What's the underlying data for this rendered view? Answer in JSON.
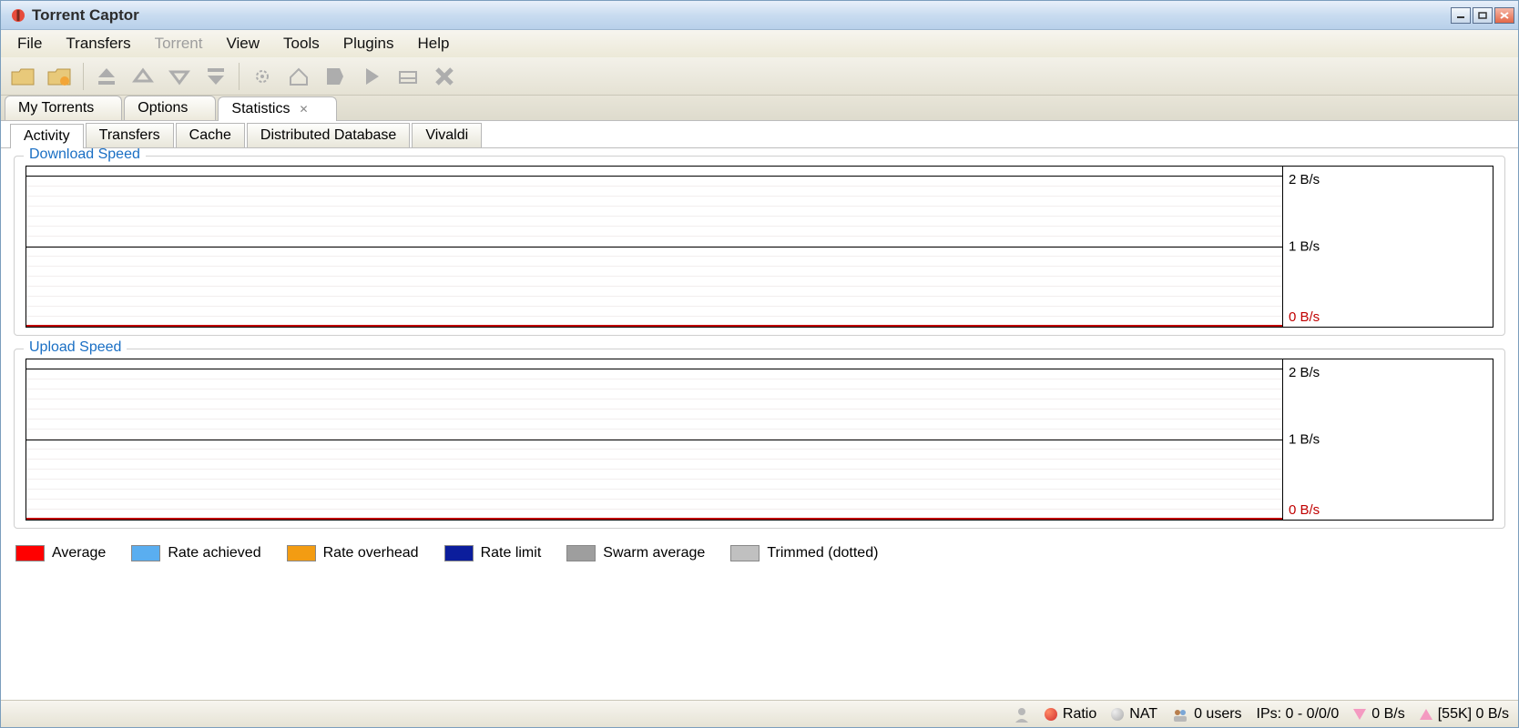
{
  "window": {
    "title": "Torrent Captor"
  },
  "menu": {
    "items": [
      "File",
      "Transfers",
      "Torrent",
      "View",
      "Tools",
      "Plugins",
      "Help"
    ],
    "disabled_index": 2
  },
  "primary_tabs": {
    "items": [
      "My Torrents",
      "Options",
      "Statistics"
    ],
    "active_index": 2,
    "closable_index": 2
  },
  "sub_tabs": {
    "items": [
      "Activity",
      "Transfers",
      "Cache",
      "Distributed Database",
      "Vivaldi"
    ],
    "active_index": 0
  },
  "charts": {
    "download": {
      "title": "Download Speed",
      "y_ticks": [
        "2 B/s",
        "1 B/s",
        "0 B/s"
      ]
    },
    "upload": {
      "title": "Upload Speed",
      "y_ticks": [
        "2 B/s",
        "1 B/s",
        "0 B/s"
      ]
    }
  },
  "legend": [
    {
      "label": "Average",
      "color": "#ff0000"
    },
    {
      "label": "Rate achieved",
      "color": "#5aaef0"
    },
    {
      "label": "Rate overhead",
      "color": "#f39c12"
    },
    {
      "label": "Rate limit",
      "color": "#0b1d9c"
    },
    {
      "label": "Swarm average",
      "color": "#9e9e9e"
    },
    {
      "label": "Trimmed (dotted)",
      "color": "#c0c0c0"
    }
  ],
  "status": {
    "ratio_label": "Ratio",
    "nat_label": "NAT",
    "users": "0 users",
    "ips": "IPs: 0 - 0/0/0",
    "down_rate": "0 B/s",
    "up_rate": "[55K] 0 B/s"
  },
  "chart_data": [
    {
      "type": "line",
      "title": "Download Speed",
      "series": [],
      "ylabel": "B/s",
      "ylim": [
        0,
        2
      ],
      "y_ticks": [
        0,
        1,
        2
      ]
    },
    {
      "type": "line",
      "title": "Upload Speed",
      "series": [],
      "ylabel": "B/s",
      "ylim": [
        0,
        2
      ],
      "y_ticks": [
        0,
        1,
        2
      ]
    }
  ]
}
